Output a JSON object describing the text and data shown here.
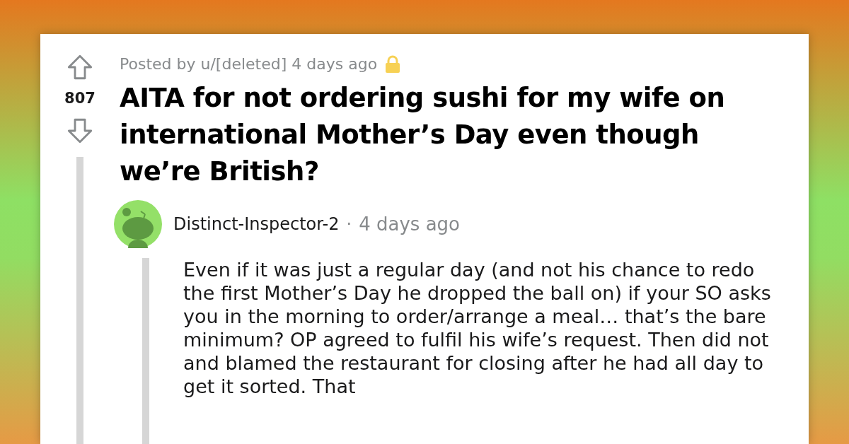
{
  "post": {
    "meta": "Posted by u/[deleted] 4 days ago",
    "locked": true,
    "score": "807",
    "title": "AITA for not ordering sushi for my wife on international Mother’s Day even though we’re British?"
  },
  "comment": {
    "author": "Distinct-Inspector-2",
    "separator": "·",
    "time": "4 days ago",
    "body": "Even if it was just a regular day (and not his chance to redo the first Mother’s Day he dropped the ball on) if your SO asks you in the morning to order/arrange a meal… that’s the bare minimum? OP agreed to fulfil his wife’s request. Then did not and blamed the restaurant for closing after he had all day to get it sorted. That"
  }
}
